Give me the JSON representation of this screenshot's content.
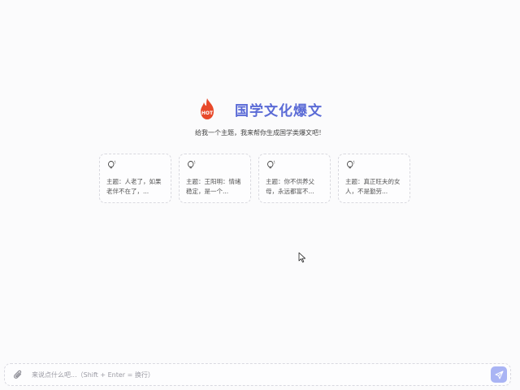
{
  "app": {
    "title": "国学文化爆文",
    "subtitle": "给我一个主题，我来帮你生成国学类爆文吧！",
    "logo_text": "HOT",
    "accent_color": "#5b6bd6",
    "logo_color": "#e8492a"
  },
  "suggestions": [
    {
      "icon": "lightbulb-icon",
      "text": "主题：人老了，如果老伴不在了，..."
    },
    {
      "icon": "lightbulb-icon",
      "text": "主题：王阳明：情绪稳定，是一个..."
    },
    {
      "icon": "lightbulb-icon",
      "text": "主题：你不供养父母，永远都富不..."
    },
    {
      "icon": "lightbulb-icon",
      "text": "主题：真正旺夫的女人，不是勤劳..."
    }
  ],
  "composer": {
    "placeholder": "来说点什么吧...（Shift + Enter = 换行）",
    "value": "",
    "attach_icon": "paperclip-icon",
    "send_icon": "send-icon",
    "send_color": "#a9b4f4"
  }
}
